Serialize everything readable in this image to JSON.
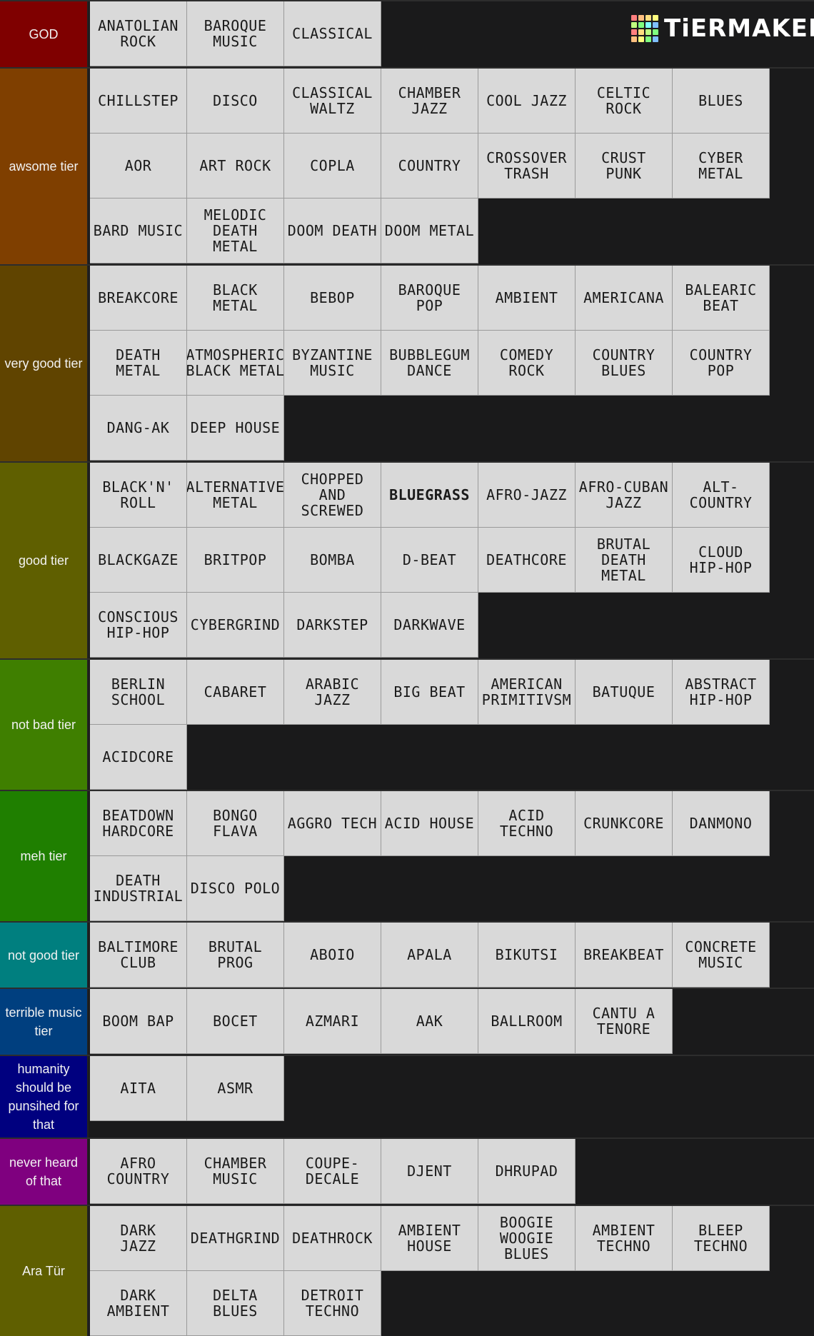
{
  "brand": {
    "logo_text": "TiERMAKER",
    "logo_colors": [
      "#ff7f7f",
      "#ffbf7f",
      "#ffdf7f",
      "#ffff7f",
      "#bfff7f",
      "#7fff7f",
      "#7fffff",
      "#7fbfff",
      "#ff7f7f",
      "#ffdf7f",
      "#bfff7f",
      "#7fff7f",
      "#ffbf7f",
      "#ffff7f",
      "#7fff7f",
      "#7fbfff"
    ]
  },
  "tiers": [
    {
      "label": "GOD",
      "color": "#7f0000",
      "items": [
        "ANATOLIAN\nROCK",
        "BAROQUE\nMUSIC",
        "CLASSICAL"
      ]
    },
    {
      "label": "awsome tier",
      "color": "#7f3f00",
      "items": [
        "CHILLSTEP",
        "DISCO",
        "CLASSICAL\nWALTZ",
        "CHAMBER\nJAZZ",
        "COOL JAZZ",
        "CELTIC\nROCK",
        "BLUES",
        "AOR",
        "ART ROCK",
        "COPLA",
        "COUNTRY",
        "CROSSOVER\nTRASH",
        "CRUST\nPUNK",
        "CYBER METAL",
        "BARD MUSIC",
        "MELODIC\nDEATH\nMETAL",
        "DOOM DEATH",
        "DOOM METAL"
      ]
    },
    {
      "label": "very good tier",
      "color": "#604400",
      "items": [
        "BREAKCORE",
        "BLACK METAL",
        "BEBOP",
        "BAROQUE POP",
        "AMBIENT",
        "AMERICANA",
        "BALEARIC\nBEAT",
        "DEATH METAL",
        "ATMOSPHERIC\nBLACK METAL",
        "BYZANTINE\nMUSIC",
        "BUBBLEGUM\nDANCE",
        "COMEDY\nROCK",
        "COUNTRY\nBLUES",
        "COUNTRY POP",
        "DANG-AK",
        "DEEP HOUSE"
      ]
    },
    {
      "label": "good tier",
      "color": "#5f5f00",
      "items": [
        "BLACK'N'\nROLL",
        "ALTERNATIVE\nMETAL",
        "CHOPPED\nAND\nSCREWED",
        "BLUEGRASS",
        "AFRO-JAZZ",
        "AFRO-CUBAN\nJAZZ",
        "ALT-COUNTRY",
        "BLACKGAZE",
        "BRITPOP",
        "BOMBA",
        "D-BEAT",
        "DEATHCORE",
        "BRUTAL\nDEATH\nMETAL",
        "CLOUD\nHIP-HOP",
        "CONSCIOUS\nHIP-HOP",
        "CYBERGRIND",
        "DARKSTEP",
        "DARKWAVE"
      ]
    },
    {
      "label": "not bad tier",
      "color": "#3f7f00",
      "items": [
        "BERLIN\nSCHOOL",
        "CABARET",
        "ARABIC JAZZ",
        "BIG BEAT",
        "AMERICAN\nPRIMITIVSM",
        "BATUQUE",
        "ABSTRACT\nHIP-HOP",
        "ACIDCORE"
      ]
    },
    {
      "label": "meh tier",
      "color": "#1f7f00",
      "items": [
        "BEATDOWN\nHARDCORE",
        "BONGO FLAVA",
        "AGGRO TECH",
        "ACID HOUSE",
        "ACID TECHNO",
        "CRUNKCORE",
        "DANMONO",
        "DEATH\nINDUSTRIAL",
        "DISCO POLO"
      ]
    },
    {
      "label": "not good tier",
      "color": "#007f7f",
      "items": [
        "BALTIMORE\nCLUB",
        "BRUTAL PROG",
        "ABOIO",
        "APALA",
        "BIKUTSI",
        "BREAKBEAT",
        "CONCRETE\nMUSIC"
      ]
    },
    {
      "label": "terrible music tier",
      "color": "#003f7f",
      "items": [
        "BOOM BAP",
        "BOCET",
        "AZMARI",
        "AAK",
        "BALLROOM",
        "CANTU A\nTENORE"
      ]
    },
    {
      "label": "humanity should be punsihed for that",
      "color": "#00007f",
      "items": [
        "AITA",
        "ASMR"
      ]
    },
    {
      "label": "never heard of that",
      "color": "#7f007f",
      "items": [
        "AFRO COUNTRY",
        "CHAMBER\nMUSIC",
        "COUPE-DECALE",
        "DJENT",
        "DHRUPAD"
      ]
    },
    {
      "label": "Ara Tür",
      "color": "#5f5f00",
      "items": [
        "DARK\nJAZZ",
        "DEATHGRIND",
        "DEATHROCK",
        "AMBIENT\nHOUSE",
        "BOOGIE WOOGIE\nBLUES",
        "AMBIENT\nTECHNO",
        "BLEEP\nTECHNO",
        "DARK\nAMBIENT",
        "DELTA\nBLUES",
        "DETROIT\nTECHNO"
      ]
    }
  ]
}
